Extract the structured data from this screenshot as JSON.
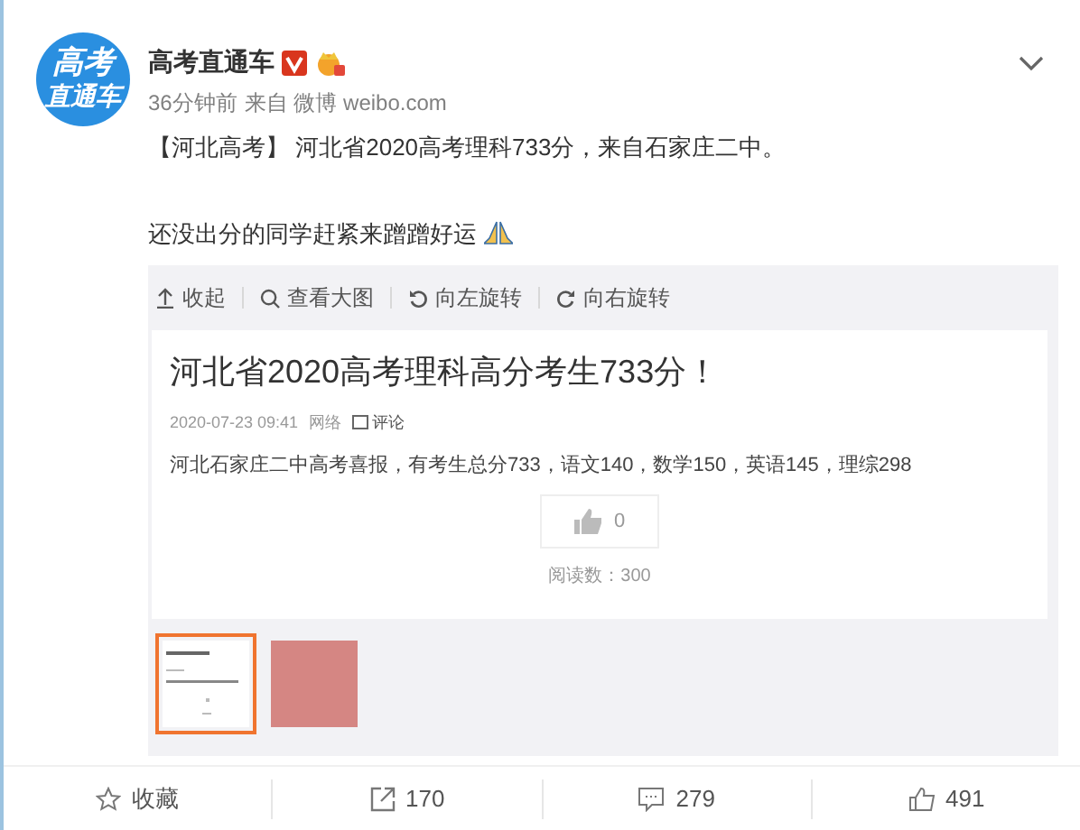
{
  "post": {
    "author": "高考直通车",
    "time": "36分钟前",
    "source": "来自 微博 weibo.com",
    "avatar_lines": [
      "高考",
      "直通车"
    ],
    "paragraphs": [
      "【河北高考】 河北省2020高考理科733分，来自石家庄二中。",
      "还没出分的同学赶紧来蹭蹭好运"
    ]
  },
  "media_toolbar": [
    {
      "kind": "collapse",
      "label": "收起"
    },
    {
      "kind": "zoom",
      "label": "查看大图"
    },
    {
      "kind": "rotate-left",
      "label": "向左旋转"
    },
    {
      "kind": "rotate-right",
      "label": "向右旋转"
    }
  ],
  "article": {
    "title": "河北省2020高考理科高分考生733分！",
    "date": "2020-07-23 09:41",
    "tag": "网络",
    "comment": "评论",
    "body": "河北石家庄二中高考喜报，有考生总分733，语文140，数学150，英语145，理综298",
    "likes": "0",
    "reads": "阅读数：300"
  },
  "thumbnails": [
    {
      "kind": "screenshot",
      "selected": true
    },
    {
      "kind": "photo",
      "selected": false
    }
  ],
  "actions": [
    {
      "kind": "favorite",
      "label": "收藏"
    },
    {
      "kind": "repost",
      "label": "170"
    },
    {
      "kind": "comment",
      "label": "279"
    },
    {
      "kind": "like",
      "label": "491"
    }
  ]
}
